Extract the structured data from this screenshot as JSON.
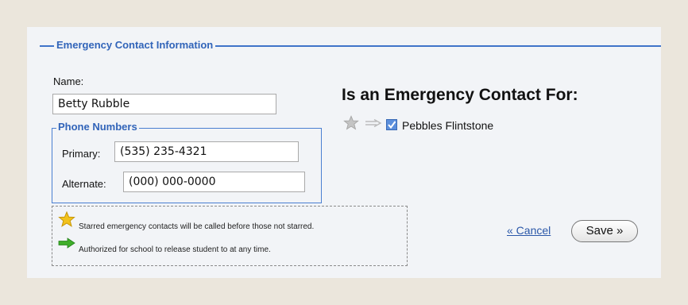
{
  "form": {
    "legend": "Emergency Contact Information",
    "name_label": "Name:",
    "name_value": "Betty Rubble",
    "phone_legend": "Phone Numbers",
    "primary_label": "Primary:",
    "primary_value": "(535) 235-4321",
    "alternate_label": "Alternate:",
    "alternate_value": "(000) 000-0000"
  },
  "legend_notes": {
    "starred": "Starred emergency contacts will be called before those not starred.",
    "authorized": "Authorized for school to release student to at any time."
  },
  "contacts": {
    "heading": "Is an Emergency Contact For:",
    "items": [
      {
        "name": "Pebbles Flintstone",
        "starred": false,
        "authorized": false,
        "checked": true
      }
    ]
  },
  "actions": {
    "cancel_label": "« Cancel",
    "save_label": "Save »"
  },
  "colors": {
    "accent": "#3164b9",
    "star_gold": "#f2c21b",
    "arrow_green": "#3fae2a",
    "inactive_gray": "#b9b9b9"
  },
  "icons": [
    "star-icon",
    "right-arrow-icon",
    "checkbox-checked-icon"
  ]
}
